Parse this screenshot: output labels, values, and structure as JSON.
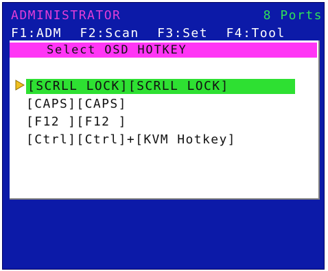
{
  "header": {
    "role": "ADMINISTRATOR",
    "ports": "8 Ports"
  },
  "function_keys": [
    {
      "label": "F1:ADM"
    },
    {
      "label": "F2:Scan"
    },
    {
      "label": "F3:Set"
    },
    {
      "label": "F4:Tool"
    }
  ],
  "dialog": {
    "title": "Select OSD HOTKEY",
    "selected_index": 0,
    "options": [
      "[SCRLL LOCK][SCRLL LOCK]",
      "[CAPS][CAPS]",
      "[F12 ][F12 ]",
      "[Ctrl][Ctrl]+[KVM Hotkey]"
    ]
  },
  "colors": {
    "background": "#0c1aa8",
    "role_text": "#e23dd8",
    "ports_text": "#2fe05a",
    "header_bar": "#ff36f5",
    "selection": "#2ee032",
    "pointer": "#f0c020"
  },
  "icons": {
    "pointer": "selection-pointer-icon"
  }
}
